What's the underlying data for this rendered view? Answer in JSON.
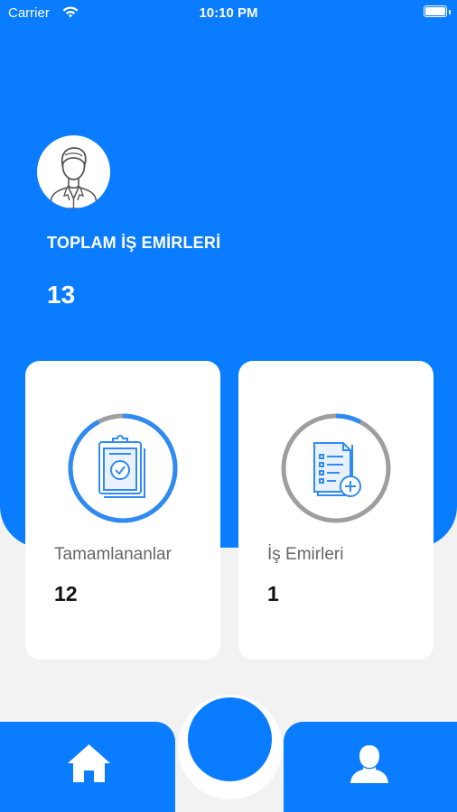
{
  "status_bar": {
    "carrier": "Carrier",
    "time": "10:10 PM"
  },
  "summary": {
    "total_label": "TOPLAM İŞ EMİRLERİ",
    "total_value": "13"
  },
  "cards": [
    {
      "label": "Tamamlananlar",
      "value": "12",
      "icon": "clipboard-check-icon",
      "progress": 0.923
    },
    {
      "label": "İş Emirleri",
      "value": "1",
      "icon": "document-add-icon",
      "progress": 0.077
    }
  ],
  "tabbar": {
    "items": [
      {
        "icon": "home-icon"
      },
      {
        "icon": "center-action"
      },
      {
        "icon": "profile-icon"
      }
    ]
  },
  "colors": {
    "primary": "#0a7cff",
    "ring_track": "#9e9e9e",
    "ring_progress": "#2f8bf2",
    "background": "#f2f2f2"
  }
}
